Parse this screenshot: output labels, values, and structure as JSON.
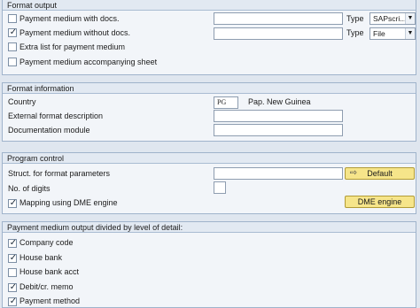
{
  "format_output": {
    "title": "Format output",
    "items": [
      {
        "label": "Payment medium with docs.",
        "checked": false
      },
      {
        "label": "Payment medium without docs.",
        "checked": true
      },
      {
        "label": "Extra list for payment medium",
        "checked": false
      },
      {
        "label": "Payment medium accompanying sheet",
        "checked": false
      }
    ],
    "type_label": "Type",
    "type_values": [
      "SAPscri...",
      "File"
    ]
  },
  "format_info": {
    "title": "Format information",
    "country_label": "Country",
    "country_code": "PG",
    "country_name": "Pap. New Guinea",
    "ext_desc_label": "External format description",
    "ext_desc_value": "",
    "doc_module_label": "Documentation module",
    "doc_module_value": ""
  },
  "program_control": {
    "title": "Program control",
    "struct_label": "Struct. for format parameters",
    "struct_value": "",
    "default_button": "Default",
    "digits_label": "No. of digits",
    "digits_value": "",
    "mapping_label": "Mapping using DME engine",
    "mapping_checked": true,
    "dme_button": "DME engine"
  },
  "detail_level": {
    "title": "Payment medium output divided by level of detail:",
    "items": [
      {
        "label": "Company code",
        "checked": true
      },
      {
        "label": "House bank",
        "checked": true
      },
      {
        "label": "House bank acct",
        "checked": false
      },
      {
        "label": "Debit/cr. memo",
        "checked": true
      },
      {
        "label": "Payment method",
        "checked": true
      }
    ]
  },
  "checkmark_glyph": "✓"
}
